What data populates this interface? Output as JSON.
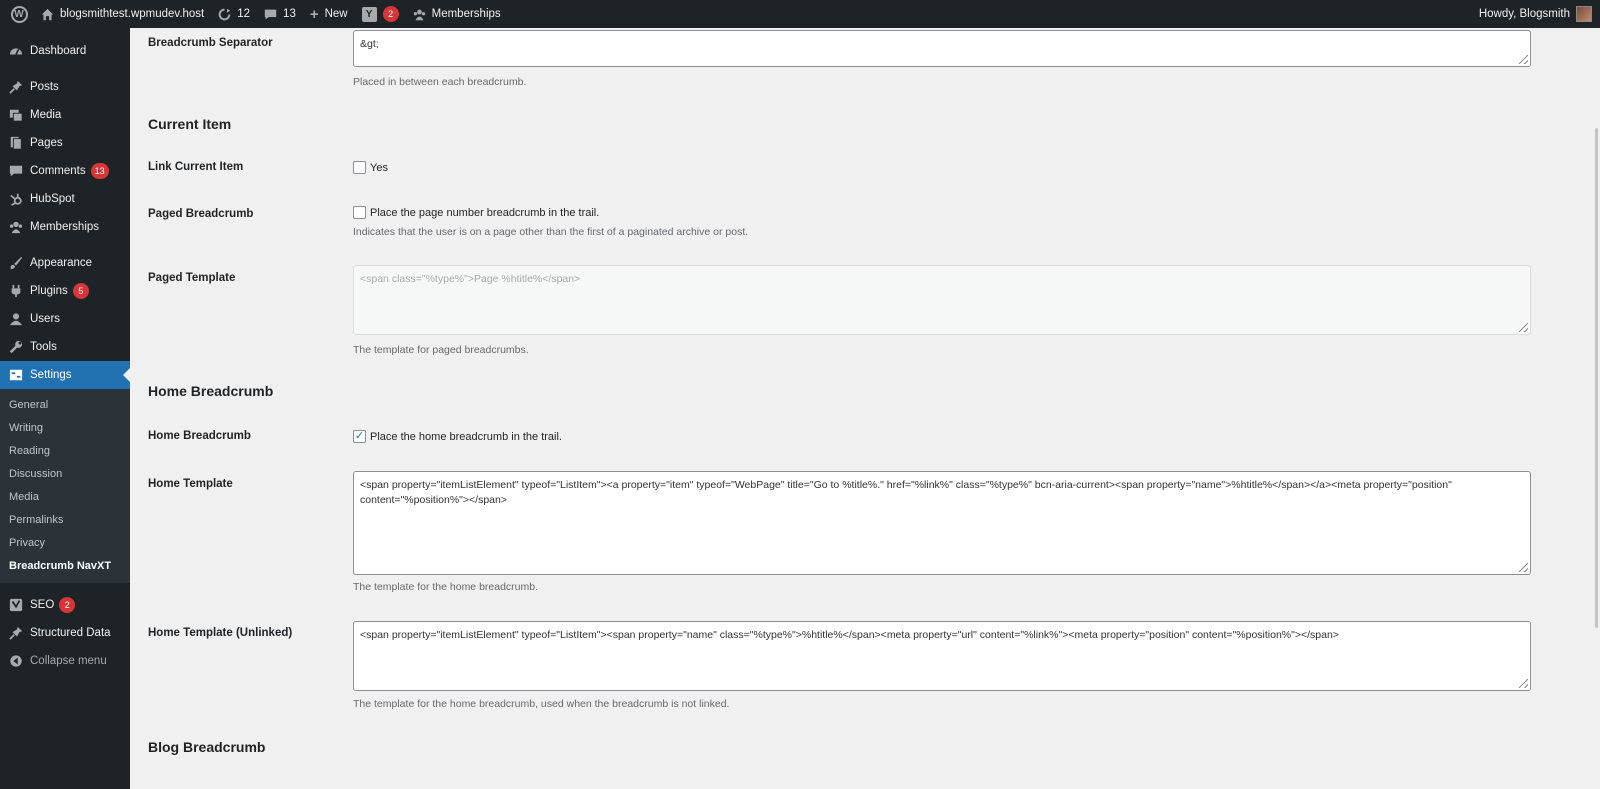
{
  "adminbar": {
    "site_name": "blogsmithtest.wpmudev.host",
    "updates_count": "12",
    "comments_count": "13",
    "new_label": "New",
    "yoast_badge": "2",
    "memberships_label": "Memberships",
    "howdy": "Howdy, Blogsmith"
  },
  "sidebar": {
    "dashboard": "Dashboard",
    "posts": "Posts",
    "media": "Media",
    "pages": "Pages",
    "comments": "Comments",
    "comments_badge": "13",
    "hubspot": "HubSpot",
    "memberships": "Memberships",
    "appearance": "Appearance",
    "plugins": "Plugins",
    "plugins_badge": "5",
    "users": "Users",
    "tools": "Tools",
    "settings": "Settings",
    "submenu": {
      "general": "General",
      "writing": "Writing",
      "reading": "Reading",
      "discussion": "Discussion",
      "media": "Media",
      "permalinks": "Permalinks",
      "privacy": "Privacy",
      "breadcrumb": "Breadcrumb NavXT"
    },
    "seo": "SEO",
    "seo_badge": "2",
    "structured_data": "Structured Data",
    "collapse": "Collapse menu"
  },
  "main": {
    "separator_label": "Breadcrumb Separator",
    "separator_value": "&gt;",
    "separator_desc": "Placed in between each breadcrumb.",
    "current_item_title": "Current Item",
    "link_current_label": "Link Current Item",
    "link_current_option": "Yes",
    "paged_label": "Paged Breadcrumb",
    "paged_option": "Place the page number breadcrumb in the trail.",
    "paged_desc": "Indicates that the user is on a page other than the first of a paginated archive or post.",
    "paged_template_label": "Paged Template",
    "paged_template_value": "<span class=\"%type%\">Page %htitle%</span>",
    "paged_template_desc": "The template for paged breadcrumbs.",
    "home_title": "Home Breadcrumb",
    "home_label": "Home Breadcrumb",
    "home_option": "Place the home breadcrumb in the trail.",
    "home_template_label": "Home Template",
    "home_template_value": "<span property=\"itemListElement\" typeof=\"ListItem\"><a property=\"item\" typeof=\"WebPage\" title=\"Go to %title%.\" href=\"%link%\" class=\"%type%\" bcn-aria-current><span property=\"name\">%htitle%</span></a><meta property=\"position\" content=\"%position%\"></span>",
    "home_template_desc": "The template for the home breadcrumb.",
    "home_unlinked_label": "Home Template (Unlinked)",
    "home_unlinked_value": "<span property=\"itemListElement\" typeof=\"ListItem\"><span property=\"name\" class=\"%type%\">%htitle%</span><meta property=\"url\" content=\"%link%\"><meta property=\"position\" content=\"%position%\"></span>",
    "home_unlinked_desc": "The template for the home breadcrumb, used when the breadcrumb is not linked.",
    "blog_title": "Blog Breadcrumb"
  },
  "colors": {
    "adminbar_bg": "#1d2327",
    "active_menu": "#2271b1",
    "badge": "#d63638",
    "page_bg": "#f0f0f1"
  },
  "icons": {
    "wordpress": "wordpress-logo-icon",
    "home": "home-icon",
    "updates": "refresh-icon",
    "comments": "comment-bubble-icon",
    "new": "plus-icon"
  }
}
